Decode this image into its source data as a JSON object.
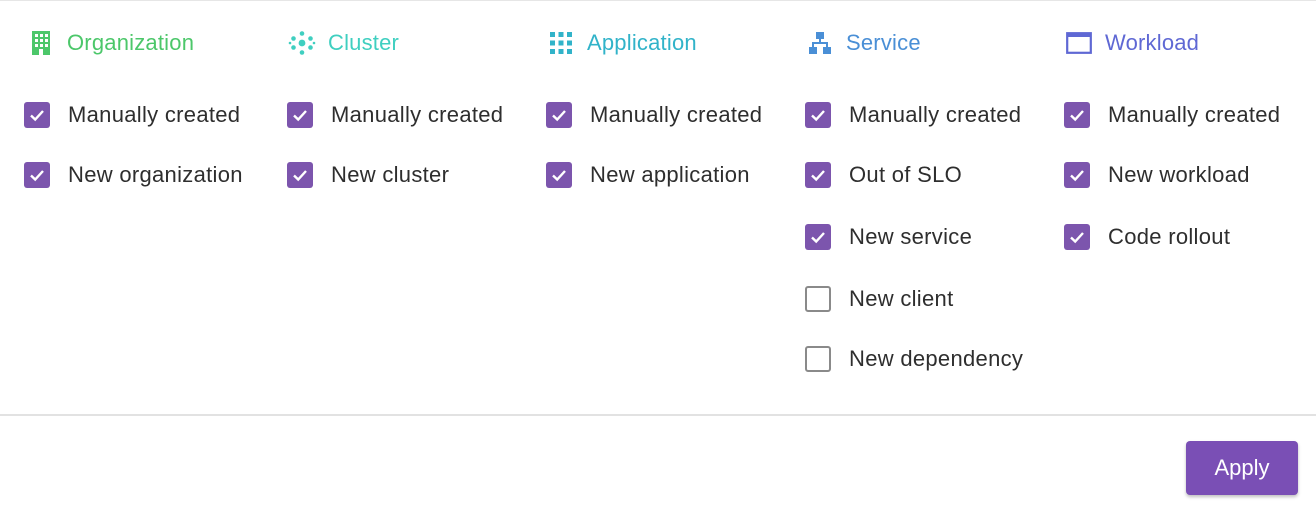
{
  "colors": {
    "checkbox_checked": "#7c55ad",
    "apply_button": "#7a4fb5"
  },
  "columns": [
    {
      "title": "Organization",
      "icon": "building-icon",
      "color": "#4cc76a",
      "options": [
        {
          "label": "Manually created",
          "checked": true
        },
        {
          "label": "New organization",
          "checked": true
        }
      ]
    },
    {
      "title": "Cluster",
      "icon": "cluster-dots-icon",
      "color": "#3fcfc0",
      "options": [
        {
          "label": "Manually created",
          "checked": true
        },
        {
          "label": "New cluster",
          "checked": true
        }
      ]
    },
    {
      "title": "Application",
      "icon": "grid-icon",
      "color": "#31b3c9",
      "options": [
        {
          "label": "Manually created",
          "checked": true
        },
        {
          "label": "New application",
          "checked": true
        }
      ]
    },
    {
      "title": "Service",
      "icon": "hierarchy-icon",
      "color": "#4a8fd6",
      "options": [
        {
          "label": "Manually created",
          "checked": true
        },
        {
          "label": "Out of SLO",
          "checked": true
        },
        {
          "label": "New service",
          "checked": true
        },
        {
          "label": "New client",
          "checked": false
        },
        {
          "label": "New dependency",
          "checked": false
        }
      ]
    },
    {
      "title": "Workload",
      "icon": "window-icon",
      "color": "#5f68d4",
      "options": [
        {
          "label": "Manually created",
          "checked": true
        },
        {
          "label": "New workload",
          "checked": true
        },
        {
          "label": "Code rollout",
          "checked": true
        }
      ]
    }
  ],
  "footer": {
    "apply_label": "Apply"
  }
}
